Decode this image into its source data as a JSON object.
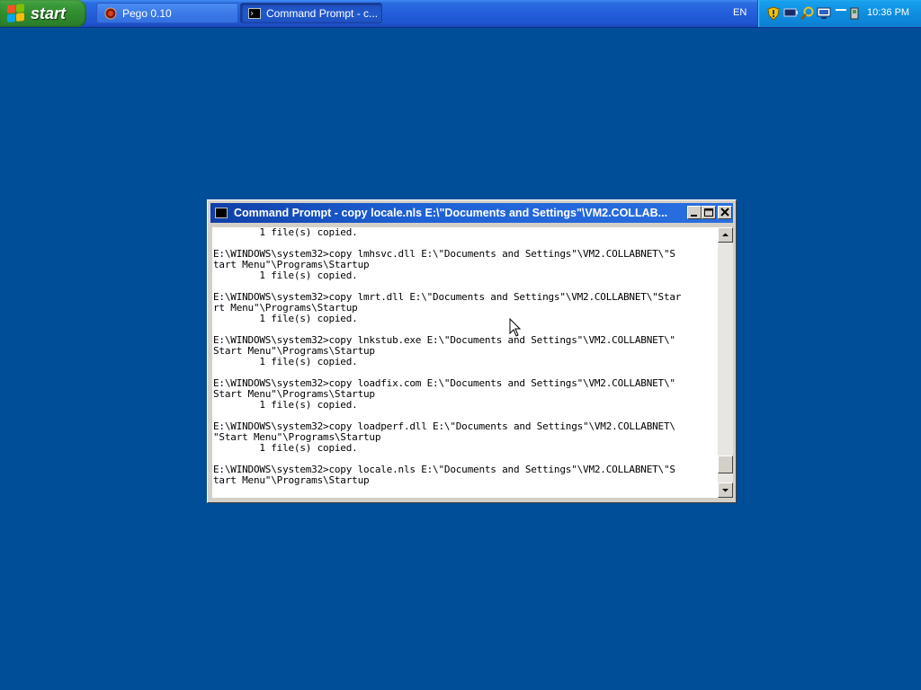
{
  "taskbar": {
    "start_label": "start",
    "tasks": [
      {
        "label": "Pego 0.10",
        "icon": "pego-app-icon",
        "active": false
      },
      {
        "label": "Command Prompt - c...",
        "icon": "console-icon",
        "active": true
      }
    ],
    "language": "EN",
    "tray_icons": [
      "security-shield-icon",
      "battery-icon",
      "search-magnifier-icon",
      "network-computer-icon",
      "minimize-tray-icon",
      "safely-remove-hardware-icon"
    ],
    "clock": "10:36 PM"
  },
  "window": {
    "title": "Command Prompt - copy locale.nls E:\\\"Documents and Settings\"\\VM2.COLLAB...",
    "console_lines": [
      "        1 file(s) copied.",
      "",
      "E:\\WINDOWS\\system32>copy lmhsvc.dll E:\\\"Documents and Settings\"\\VM2.COLLABNET\\\"S",
      "tart Menu\"\\Programs\\Startup",
      "        1 file(s) copied.",
      "",
      "E:\\WINDOWS\\system32>copy lmrt.dll E:\\\"Documents and Settings\"\\VM2.COLLABNET\\\"Star",
      "rt Menu\"\\Programs\\Startup",
      "        1 file(s) copied.",
      "",
      "E:\\WINDOWS\\system32>copy lnkstub.exe E:\\\"Documents and Settings\"\\VM2.COLLABNET\\\"",
      "Start Menu\"\\Programs\\Startup",
      "        1 file(s) copied.",
      "",
      "E:\\WINDOWS\\system32>copy loadfix.com E:\\\"Documents and Settings\"\\VM2.COLLABNET\\\"",
      "Start Menu\"\\Programs\\Startup",
      "        1 file(s) copied.",
      "",
      "E:\\WINDOWS\\system32>copy loadperf.dll E:\\\"Documents and Settings\"\\VM2.COLLABNET\\",
      "\"Start Menu\"\\Programs\\Startup",
      "        1 file(s) copied.",
      "",
      "E:\\WINDOWS\\system32>copy locale.nls E:\\\"Documents and Settings\"\\VM2.COLLABNET\\\"S",
      "tart Menu\"\\Programs\\Startup"
    ],
    "scroll_position": 0.96
  },
  "colors": {
    "desktop": "#004e98",
    "taskbar": "#245edb",
    "start": "#3c9b3a",
    "tray": "#0f8ee0"
  }
}
